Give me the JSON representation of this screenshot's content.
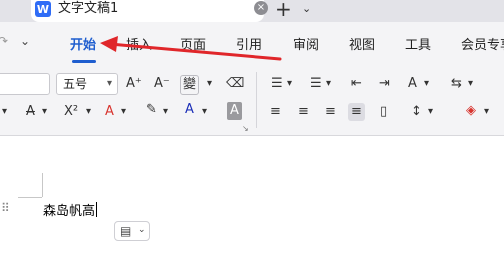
{
  "tabbar": {
    "doc_icon": "W",
    "doc_title": "文字文稿1",
    "close_glyph": "×",
    "add_glyph": "+",
    "chevron_glyph": "⌄"
  },
  "menubar": {
    "chevron_glyph": "⌄",
    "items": [
      "开始",
      "插入",
      "页面",
      "引用",
      "审阅",
      "视图",
      "工具",
      "会员专享"
    ],
    "active_index": 0
  },
  "ribbon": {
    "font_size_value": "五号",
    "row1": {
      "grow_font": "A⁺",
      "shrink_font": "A⁻",
      "phonetic": "變",
      "clear_format": "⌫",
      "bullets": "☰",
      "numbering": "☰",
      "outdent": "⇤",
      "indent": "⇥",
      "text_direction": "A",
      "line_tool": "⇆"
    },
    "row2": {
      "strikethrough": "A",
      "superscript": "X²",
      "text_effect": "A",
      "highlight": "✎",
      "font_color": "A",
      "char_shading": "A",
      "align_left": "≡",
      "align_center": "≡",
      "align_right": "≡",
      "align_justify": "≡",
      "distributed": "▯",
      "line_spacing": "↕",
      "eraser": "◈"
    },
    "dropdown_glyph": "▾",
    "corner_glyph": "↘",
    "colors": {
      "highlight": "#f5d400",
      "font_color": "#1c2fb8",
      "eraser": "#d8342e"
    }
  },
  "document": {
    "text": "森岛帆高",
    "drag_handle": "⠿"
  },
  "paste_options": {
    "icon": "📋",
    "chevron": "⌄"
  },
  "annotation": {
    "color": "#e0262a"
  },
  "colors": {
    "accent": "#1f5ecf",
    "word_icon": "#2f6cf6"
  }
}
